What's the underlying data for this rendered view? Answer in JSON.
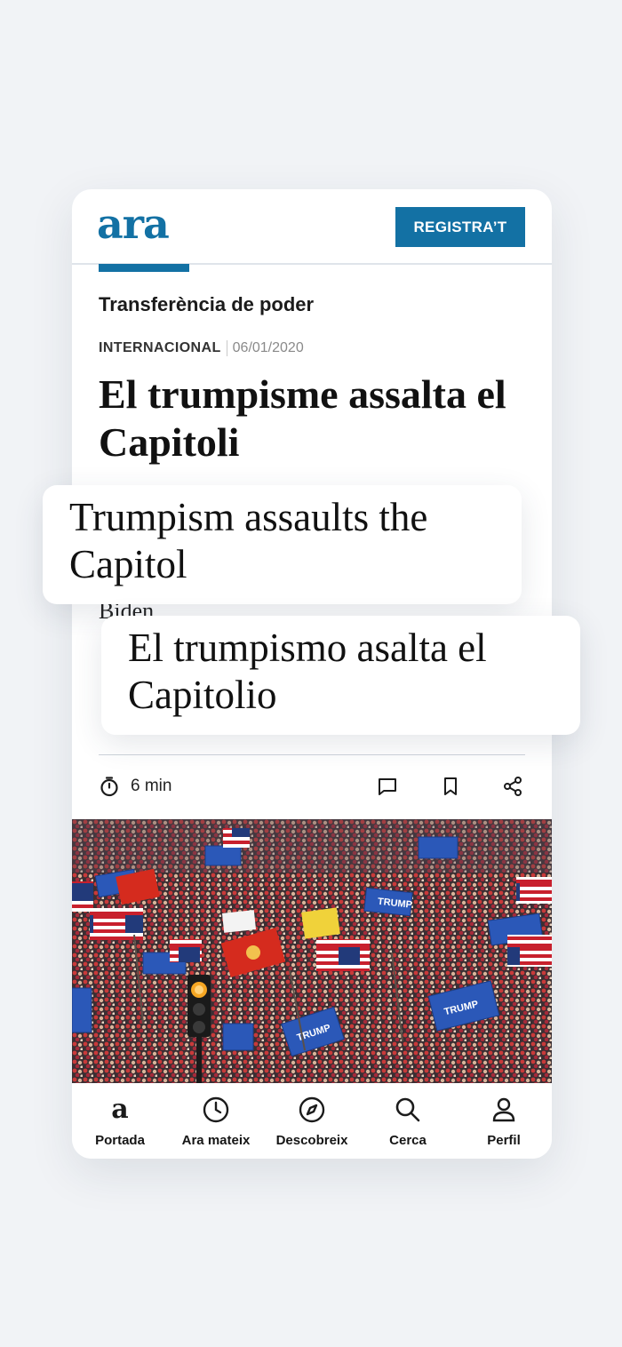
{
  "header": {
    "logo": "ara",
    "register_label": "REGISTRA’T"
  },
  "article": {
    "topic": "Transferència de poder",
    "section": "INTERNACIONAL",
    "date": "06/01/2020",
    "headline": "El trumpisme assalta el Capitoli",
    "subtext_peek": "Biden",
    "reading_time": "6 min",
    "actions": [
      "comment-icon",
      "bookmark-icon",
      "share-icon"
    ]
  },
  "translations": {
    "english": "Trumpism assaults the Capitol",
    "spanish": "El trumpismo asalta el Capitolio"
  },
  "tabbar": {
    "items": [
      {
        "label": "Portada",
        "icon": "ara-logo-icon"
      },
      {
        "label": "Ara mateix",
        "icon": "clock-icon"
      },
      {
        "label": "Descobreix",
        "icon": "compass-icon"
      },
      {
        "label": "Cerca",
        "icon": "search-icon"
      },
      {
        "label": "Perfil",
        "icon": "person-icon"
      }
    ]
  },
  "colors": {
    "brand": "#1371a4",
    "background": "#f1f3f6"
  }
}
